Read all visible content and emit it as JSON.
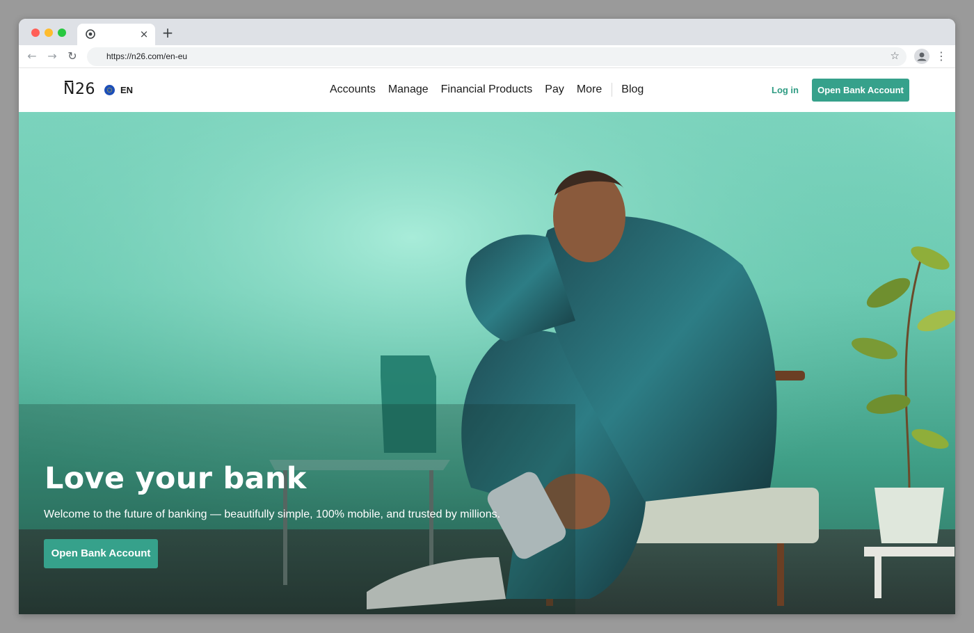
{
  "browser": {
    "url": "https://n26.com/en-eu",
    "tab_close": "×",
    "new_tab": "+",
    "back": "←",
    "forward": "→",
    "reload": "↻",
    "star": "☆",
    "menu": "⋮"
  },
  "header": {
    "logo": "N26",
    "language": "EN",
    "nav": [
      "Accounts",
      "Manage",
      "Financial Products",
      "Pay",
      "More"
    ],
    "blog": "Blog",
    "login": "Log in",
    "cta": "Open Bank Account"
  },
  "hero": {
    "title": "Love your bank",
    "subtitle": "Welcome to the future of banking — beautifully simple, 100% mobile, and trusted by millions.",
    "cta": "Open Bank Account"
  },
  "colors": {
    "brand": "#36a18b",
    "link": "#2f9c83",
    "hero_bg": "#6dcbb3"
  }
}
